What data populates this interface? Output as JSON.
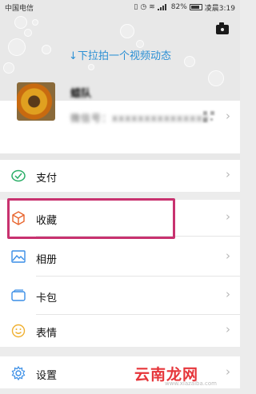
{
  "status_bar": {
    "carrier": "中国电信",
    "battery": "82%",
    "time": "凌晨3:19"
  },
  "header": {
    "pull_hint": "↓下拉拍一个视频动态",
    "camera_icon": "camera-icon"
  },
  "profile": {
    "nickname": "蜡队",
    "account": "微信号：xxxxxxxxxxxxxxx"
  },
  "menu": [
    {
      "label": "支付",
      "icon": "wallet-check-icon",
      "color": "#2aae67"
    },
    {
      "label": "收藏",
      "icon": "cube-icon",
      "color": "#e8632b"
    },
    {
      "label": "相册",
      "icon": "photo-icon",
      "color": "#3a8ee6"
    },
    {
      "label": "卡包",
      "icon": "card-icon",
      "color": "#3a8ee6"
    },
    {
      "label": "表情",
      "icon": "smile-icon",
      "color": "#f0b030"
    },
    {
      "label": "设置",
      "icon": "gear-icon",
      "color": "#3a8ee6"
    }
  ],
  "watermark": {
    "main": "云南龙网",
    "sub": "www.xiazaiba.com"
  }
}
